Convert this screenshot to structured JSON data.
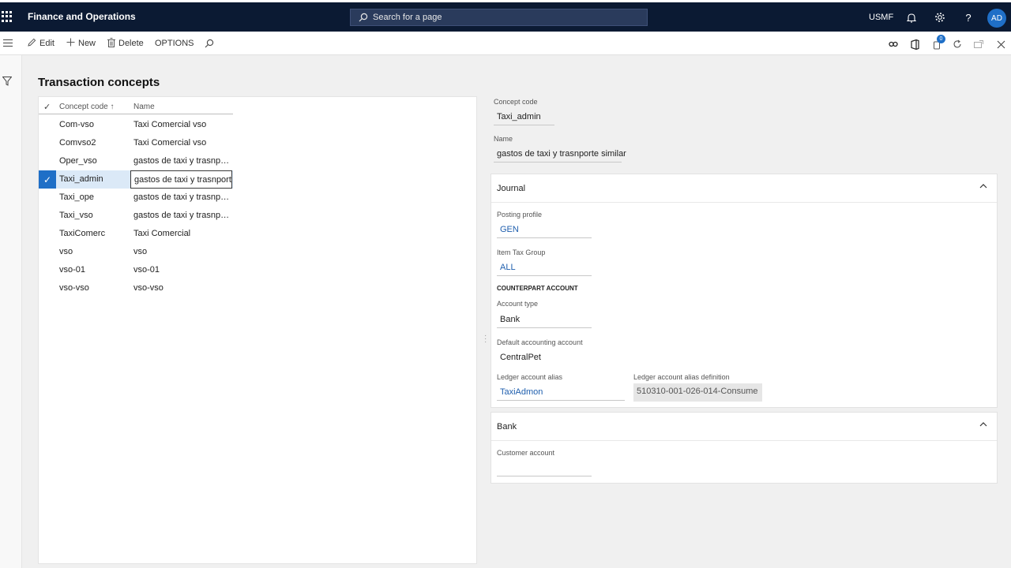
{
  "app": {
    "title": "Finance and Operations",
    "company": "USMF",
    "user_initials": "AD",
    "colors": {
      "navbar": "#0b1a33",
      "accent": "#1f6fc7"
    }
  },
  "search": {
    "placeholder": "Search for a page"
  },
  "toolbar": {
    "edit": "Edit",
    "new": "New",
    "delete": "Delete",
    "options": "OPTIONS",
    "notification_count": "0"
  },
  "page": {
    "title": "Transaction concepts"
  },
  "grid": {
    "columns": [
      "Concept code",
      "Name"
    ],
    "sort_indicator": "↑",
    "rows": [
      {
        "code": "Com-vso",
        "name": "Taxi Comercial vso"
      },
      {
        "code": "Comvso2",
        "name": "Taxi Comercial vso"
      },
      {
        "code": "Oper_vso",
        "name": "gastos de taxi y trasnporte"
      },
      {
        "code": "Taxi_admin",
        "name": "gastos de taxi y trasnporte",
        "selected": true
      },
      {
        "code": "Taxi_ope",
        "name": "gastos de taxi y trasnporte"
      },
      {
        "code": "Taxi_vso",
        "name": "gastos de taxi y trasnporte"
      },
      {
        "code": "TaxiComerc",
        "name": "Taxi Comercial"
      },
      {
        "code": "vso",
        "name": "vso"
      },
      {
        "code": "vso-01",
        "name": "vso-01"
      },
      {
        "code": "vso-vso",
        "name": "vso-vso"
      }
    ]
  },
  "details": {
    "concept_code_label": "Concept code",
    "concept_code": "Taxi_admin",
    "name_label": "Name",
    "name": "gastos de taxi y trasnporte similar"
  },
  "journal": {
    "title": "Journal",
    "posting_profile_label": "Posting profile",
    "posting_profile": "GEN",
    "item_tax_group_label": "Item Tax Group",
    "item_tax_group": "ALL",
    "counterpart_title": "COUNTERPART ACCOUNT",
    "account_type_label": "Account type",
    "account_type": "Bank",
    "default_account_label": "Default accounting account",
    "default_account": "CentralPet",
    "alias_label": "Ledger account alias",
    "alias": "TaxiAdmon",
    "alias_def_label": "Ledger account alias definition",
    "alias_def": "510310-001-026-014-Consume"
  },
  "bank": {
    "title": "Bank",
    "customer_account_label": "Customer account",
    "customer_account": ""
  },
  "icons": [
    "waffle-icon",
    "search-icon",
    "bell-icon",
    "gear-icon",
    "help-icon",
    "hamburger-icon",
    "edit-icon",
    "plus-icon",
    "trash-icon",
    "filter-icon",
    "link-icon",
    "office-icon",
    "attachment-icon",
    "refresh-icon",
    "popout-icon",
    "close-icon",
    "chevron-up-icon",
    "checkmark-icon"
  ]
}
